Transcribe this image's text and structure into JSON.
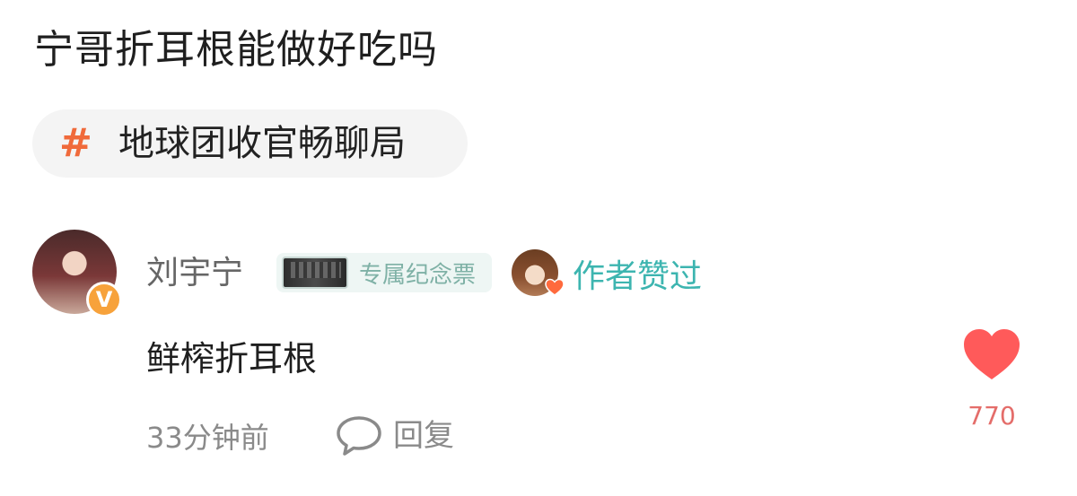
{
  "post": {
    "title": "宁哥折耳根能做好吃吗"
  },
  "topic": {
    "hash_symbol": "#",
    "label": "地球团收官畅聊局",
    "hash_color": "#f06a3b"
  },
  "comment": {
    "author": {
      "name": "刘宇宁",
      "verified_badge": "V",
      "verified_color": "#f7a23b"
    },
    "ticket_badge": {
      "label": "专属纪念票"
    },
    "author_liked": {
      "label": "作者赞过",
      "color": "#3db5b0"
    },
    "text": "鲜榨折耳根",
    "time": "33分钟前",
    "reply_label": "回复",
    "like": {
      "count": "770",
      "icon": "heart-icon",
      "color": "#ff5a5a"
    }
  }
}
